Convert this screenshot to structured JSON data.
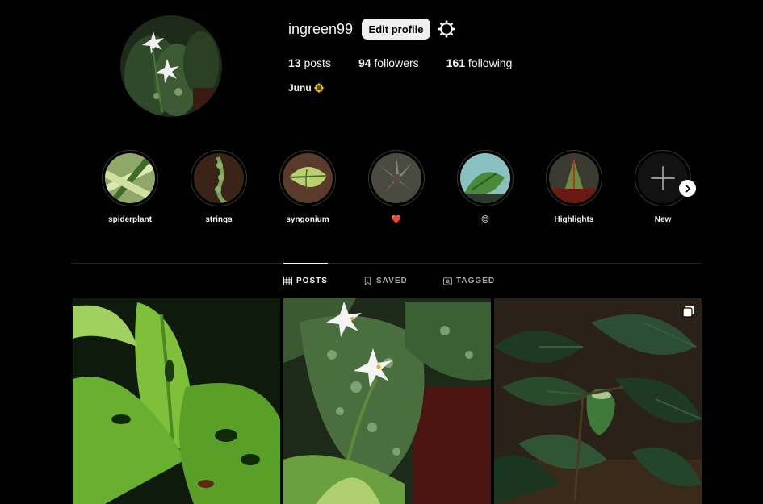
{
  "profile": {
    "username": "ingreen99",
    "edit_label": "Edit profile",
    "settings_icon": "gear-icon",
    "bio": "Junu",
    "bio_emoji": "sunflower",
    "stats": [
      {
        "count": "13",
        "label": "posts"
      },
      {
        "count": "94",
        "label": "followers"
      },
      {
        "count": "161",
        "label": "following"
      }
    ]
  },
  "highlights": [
    {
      "label": "spiderplant"
    },
    {
      "label": "strings"
    },
    {
      "label": "syngonium"
    },
    {
      "label": "❤️"
    },
    {
      "label": "😊"
    },
    {
      "label": "Highlights"
    },
    {
      "label": "New"
    }
  ],
  "tabs": [
    {
      "label": "POSTS",
      "icon": "grid-icon",
      "active": true
    },
    {
      "label": "SAVED",
      "icon": "bookmark-icon",
      "active": false
    },
    {
      "label": "TAGGED",
      "icon": "tag-icon",
      "active": false
    }
  ],
  "colors": {
    "background": "#000000",
    "divider": "#262626",
    "text": "#f5f5f5",
    "muted": "#a8a8a8",
    "button": "#efefef"
  }
}
